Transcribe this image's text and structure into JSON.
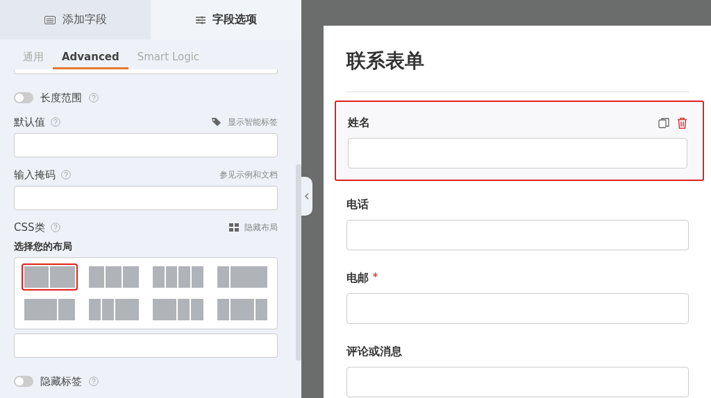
{
  "panel_tabs": [
    {
      "label": "添加字段",
      "selected": false
    },
    {
      "label": "字段选项",
      "selected": true
    }
  ],
  "sub_tabs": [
    {
      "label": "通用",
      "selected": false
    },
    {
      "label": "Advanced",
      "selected": true
    },
    {
      "label": "Smart Logic",
      "selected": false
    }
  ],
  "settings": [
    {
      "kind": "toggle",
      "label": "长度范围",
      "on": false
    },
    {
      "kind": "input",
      "label": "默认值",
      "action": "显示智能标签"
    },
    {
      "kind": "input",
      "label": "输入掩码",
      "action": "参见示例和文档"
    },
    {
      "kind": "input",
      "label": "CSS类",
      "action": "隐藏布局",
      "layout_title": "选择您的布局",
      "layouts": [
        {
          "kind": "halves",
          "selected": true
        },
        {
          "kind": "thirds",
          "selected": false
        },
        {
          "kind": "quarters",
          "selected": false
        },
        {
          "kind": "quarter-threequarter",
          "selected": false
        },
        {
          "kind": "threequarter-quarter",
          "selected": false
        },
        {
          "kind": "quarter-quarter-half",
          "selected": false
        },
        {
          "kind": "half-quarter-quarter",
          "selected": false
        },
        {
          "kind": "quarter-half-quarter",
          "selected": false
        }
      ]
    },
    {
      "kind": "toggle",
      "label": "隐藏标签",
      "on": false
    }
  ],
  "form": {
    "title": "联系表单",
    "fields": [
      {
        "label": "姓名",
        "required": false,
        "selected": true
      },
      {
        "label": "电话",
        "required": false,
        "selected": false
      },
      {
        "label": "电邮",
        "required": true,
        "selected": false
      },
      {
        "label": "评论或消息",
        "required": false,
        "selected": false
      }
    ]
  }
}
